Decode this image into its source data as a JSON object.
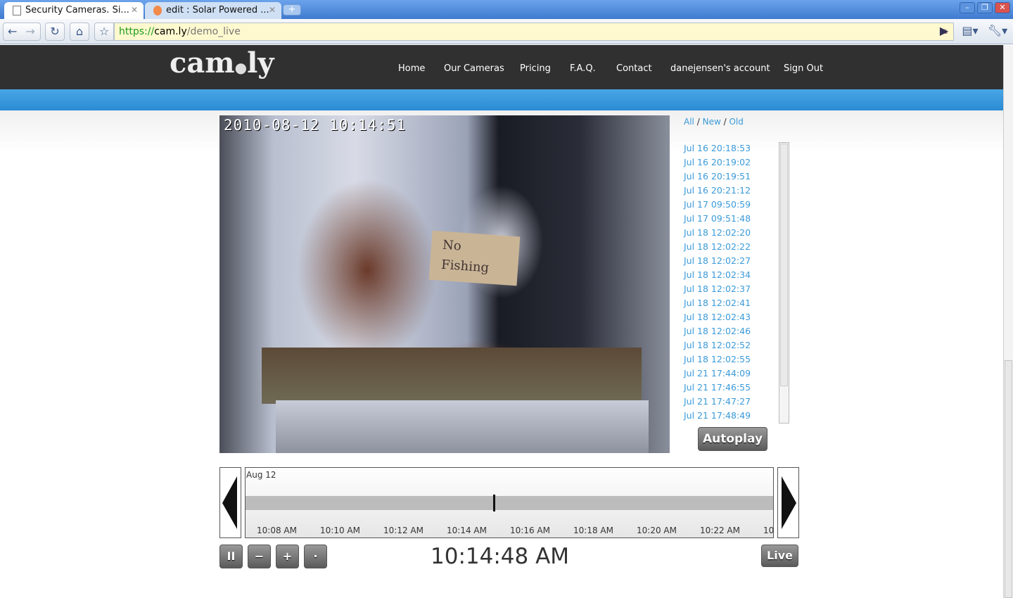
{
  "browser": {
    "tabs": [
      {
        "title": "Security Cameras. Si...",
        "active": true
      },
      {
        "title": "edit : Solar Powered ...",
        "active": false
      }
    ],
    "url_scheme": "https://",
    "url_host": "cam.ly",
    "url_path": "/demo_live"
  },
  "site": {
    "logo": "cam.ly",
    "nav": [
      "Home",
      "Our Cameras",
      "Pricing",
      "F.A.Q.",
      "Contact",
      "danejensen's account",
      "Sign Out"
    ]
  },
  "video": {
    "timestamp": "2010-08-12 10:14:51",
    "sign_text": "No Fishing"
  },
  "filters": {
    "all": "All",
    "new": "New",
    "old": "Old",
    "sep": "/"
  },
  "snapshots": [
    "Jul 16 20:18:53",
    "Jul 16 20:19:02",
    "Jul 16 20:19:51",
    "Jul 16 20:21:12",
    "Jul 17 09:50:59",
    "Jul 17 09:51:48",
    "Jul 18 12:02:20",
    "Jul 18 12:02:22",
    "Jul 18 12:02:27",
    "Jul 18 12:02:34",
    "Jul 18 12:02:37",
    "Jul 18 12:02:41",
    "Jul 18 12:02:43",
    "Jul 18 12:02:46",
    "Jul 18 12:02:52",
    "Jul 18 12:02:55",
    "Jul 21 17:44:09",
    "Jul 21 17:46:55",
    "Jul 21 17:47:27",
    "Jul 21 17:48:49"
  ],
  "autoplay_label": "Autoplay",
  "timeline": {
    "date": "Aug 12",
    "ticks": [
      "10:08 AM",
      "10:10 AM",
      "10:12 AM",
      "10:14 AM",
      "10:16 AM",
      "10:18 AM",
      "10:20 AM",
      "10:22 AM",
      "10"
    ]
  },
  "controls": {
    "pause": "II",
    "zoom_out": "−",
    "zoom_in": "+",
    "dot": "·",
    "live": "Live",
    "current_time": "10:14:48 AM"
  }
}
